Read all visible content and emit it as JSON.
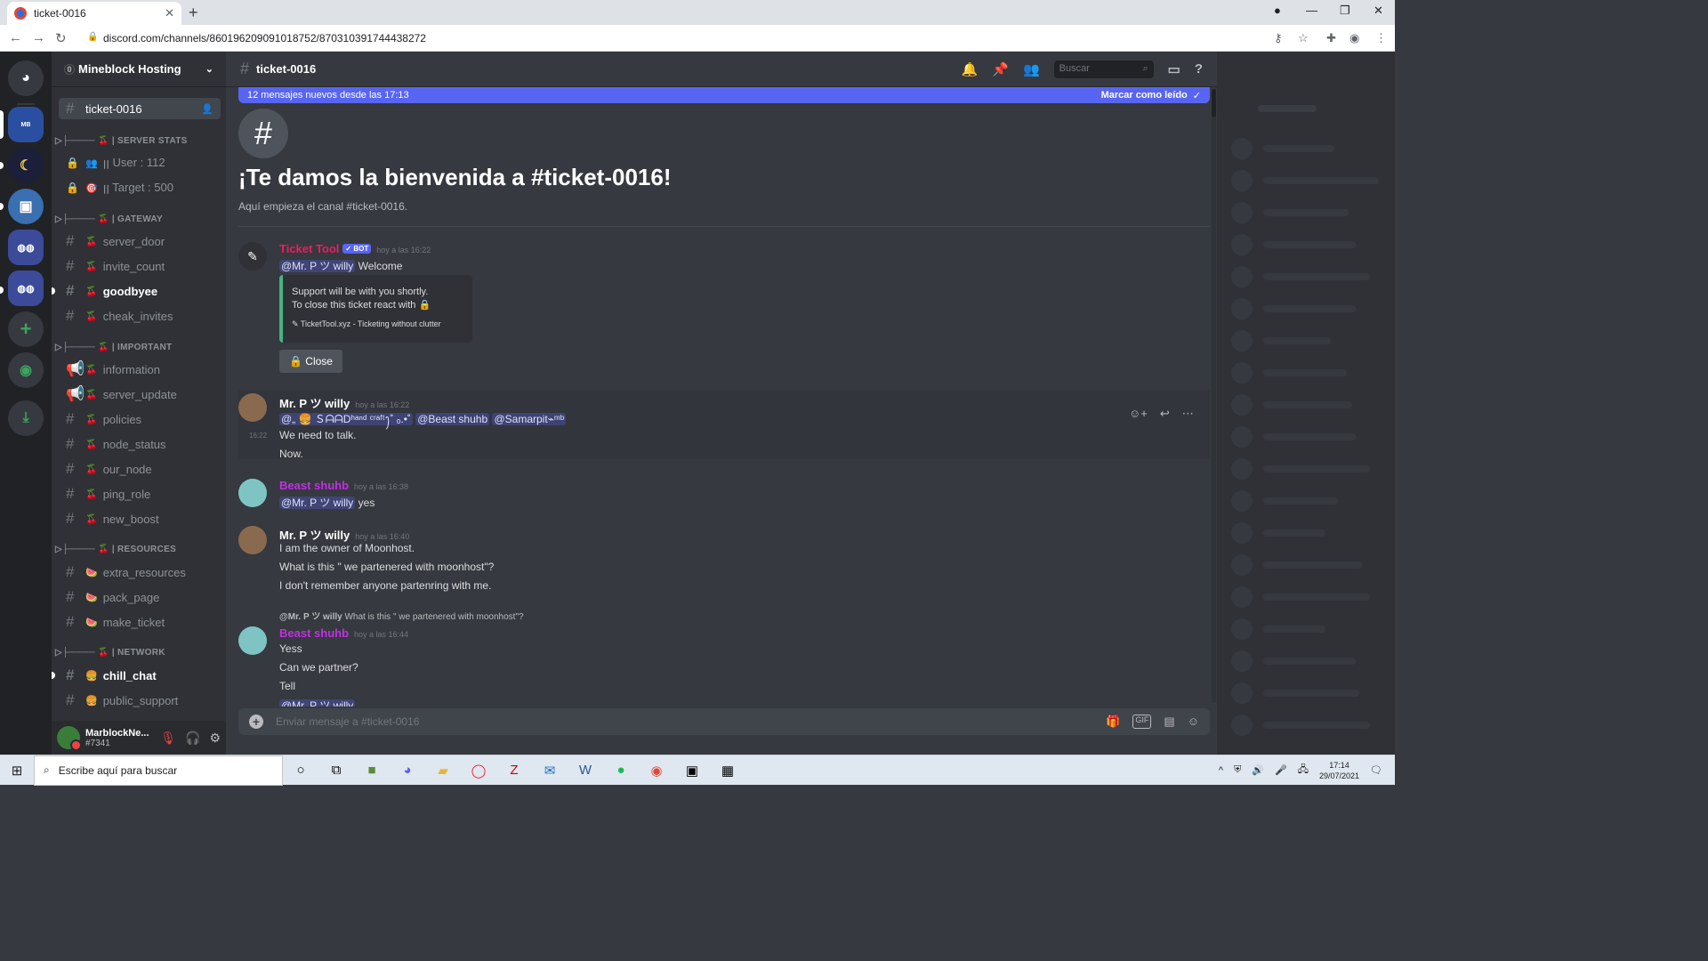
{
  "browser": {
    "tab_title": "ticket-0016",
    "url": "discord.com/channels/860196209091018752/870310391744438272"
  },
  "server": {
    "name": "Mineblock Hosting",
    "badge": "0"
  },
  "channels": {
    "active": "ticket-0016",
    "categories": [
      {
        "label": "▷├──── 🍒 | SERVER STATS"
      },
      {
        "label": "▷├──── 🍒 | GATEWAY"
      },
      {
        "label": "▷├──── 🍒 | IMPORTANT"
      },
      {
        "label": "▷├──── 🍒 | RESOURCES"
      },
      {
        "label": "▷├──── 🍒 | NETWORK"
      }
    ],
    "items": [
      {
        "name": "ꞁꞁ User : 112",
        "emoji": "👥"
      },
      {
        "name": "ꞁꞁ Target : 500",
        "emoji": "🎯"
      },
      {
        "name": "server_door",
        "emoji": "🍒"
      },
      {
        "name": "invite_count",
        "emoji": "🍒"
      },
      {
        "name": "goodbyee",
        "emoji": "🍒"
      },
      {
        "name": "cheak_invites",
        "emoji": "🍒"
      },
      {
        "name": "information",
        "emoji": "🍒"
      },
      {
        "name": "server_update",
        "emoji": "🍒"
      },
      {
        "name": "policies",
        "emoji": "🍒"
      },
      {
        "name": "node_status",
        "emoji": "🍒"
      },
      {
        "name": "our_node",
        "emoji": "🍒"
      },
      {
        "name": "ping_role",
        "emoji": "🍒"
      },
      {
        "name": "new_boost",
        "emoji": "🍒"
      },
      {
        "name": "extra_resources",
        "emoji": "🍉"
      },
      {
        "name": "pack_page",
        "emoji": "🍉"
      },
      {
        "name": "make_ticket",
        "emoji": "🍉"
      },
      {
        "name": "chill_chat",
        "emoji": "🍔"
      },
      {
        "name": "public_support",
        "emoji": "🍔"
      }
    ]
  },
  "user": {
    "name": "MarblockNe...",
    "tag": "#7341"
  },
  "header": {
    "channel": "ticket-0016",
    "search_placeholder": "Buscar"
  },
  "new_messages": {
    "text": "12 mensajes nuevos desde las 17:13",
    "mark_read": "Marcar como leído"
  },
  "welcome": {
    "title": "¡Te damos la bienvenida a #ticket-0016!",
    "subtitle": "Aquí empieza el canal #ticket-0016."
  },
  "messages": {
    "m1": {
      "author": "Ticket Tool",
      "bot": "✓ BOT",
      "time": "hoy a las 16:22",
      "mention": "@Mr. P ツ willy",
      "text": " Welcome",
      "embed_line1": "Support will be with you shortly.",
      "embed_line2": "To close this ticket react with 🔒",
      "embed_footer": "TicketTool.xyz - Ticketing without clutter",
      "button": "🔒 Close"
    },
    "m2": {
      "author": "Mr. P ツ willy",
      "time": "hoy a las 16:22",
      "mention1": "@„ 🍔 ＳᗩᗩDʰᵃⁿᵈ ᶜʳᵃᶠᵗꫂ˚ ₒ.•˚",
      "mention2": "@Beast shuhb",
      "mention3": "@Samarpit⌁ᵐᵇ",
      "side_time": "16:22",
      "line1": "We need to talk.",
      "line2": "Now."
    },
    "m3": {
      "author": "Beast shuhb",
      "time": "hoy a las 16:38",
      "mention": "@Mr. P ツ willy",
      "text": " yes"
    },
    "m4": {
      "author": "Mr. P ツ willy",
      "time": "hoy a las 16:40",
      "line1": "I am the owner of Moonhost.",
      "line2": "What is this \" we partenered with moonhost\"?",
      "line3": "I don't remember anyone partenring with me."
    },
    "m5": {
      "reply_author": "@Mr. P ツ willy",
      "reply_text": "What is this \" we partenered with moonhost\"?",
      "author": "Beast shuhb",
      "time": "hoy a las 16:44",
      "line1": "Yess",
      "line2": "Can we partner?",
      "line3": "Tell",
      "line4": "@Mr. P ツ willy"
    }
  },
  "composer": {
    "placeholder": "Enviar mensaje a #ticket-0016",
    "gif": "GIF"
  },
  "taskbar": {
    "search": "Escribe aquí para buscar",
    "time": "17:14",
    "date": "29/07/2021"
  },
  "colors": {
    "accent": "#5865f2",
    "bot_author": "#e91e63",
    "member_author": "#c32ee6"
  }
}
